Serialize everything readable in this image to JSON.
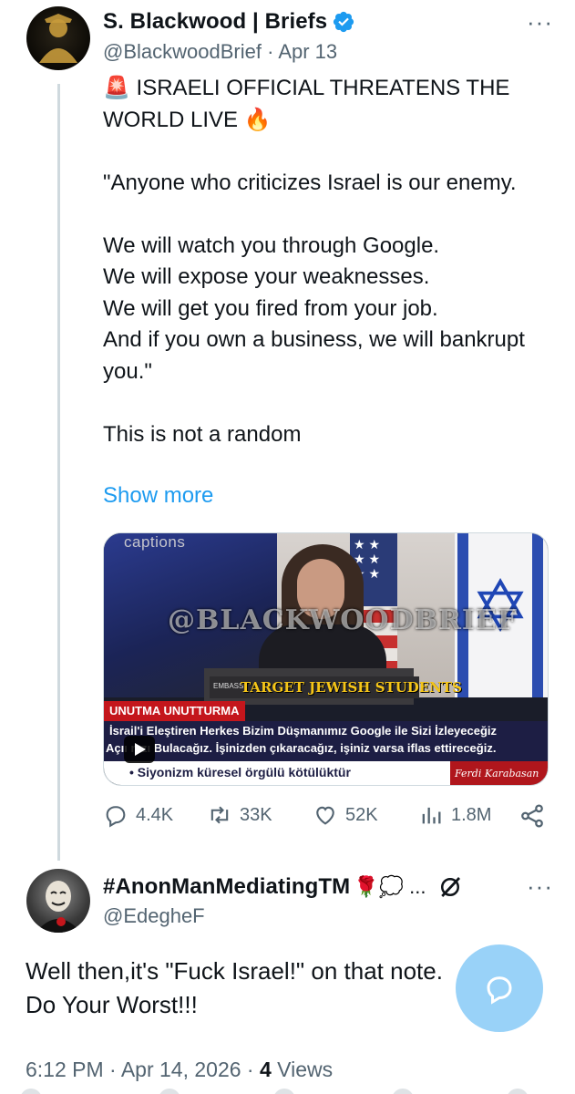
{
  "original_tweet": {
    "author": {
      "display_name": "S. Blackwood | Briefs",
      "handle": "@BlackwoodBrief",
      "date": "Apr 13",
      "verified": true
    },
    "more_label": "···",
    "text": "🚨 ISRAELI OFFICIAL THREATENS THE WORLD LIVE 🔥\n\n\"Anyone who criticizes Israel is our enemy.\n\nWe will watch you through Google.\nWe will expose your weaknesses.\nWe will get you fired from your job.\nAnd if you own a business, we will bankrupt you.\"\n\nThis is not a random",
    "show_more_label": "Show more",
    "media": {
      "captions_label": "captions",
      "watermark": "@BLACKWOODBRIEF",
      "overlay_title": "TARGET JEWISH STUDENTS",
      "podium_text": "EMBASSY",
      "tag": "UNUTMA UNUTTURMA",
      "subtitle_line1": "İsrail'i Eleştiren Herkes Bizim Düşmanımız Google ile Sizi İzleyeceğiz",
      "subtitle_line2": "Açıı  nızı Bulacağız. İşinizden çıkaracağız, işiniz varsa iflas ettireceğiz.",
      "ticker": "• Siyonizm küresel örgülü kötülüktür",
      "signature": "Ferdi Karabasan"
    },
    "actions": {
      "replies": "4.4K",
      "reposts": "33K",
      "likes": "52K",
      "views": "1.8M"
    }
  },
  "reply_tweet": {
    "author": {
      "display_name": "#AnonManMediatingTM",
      "emoji_suffix": "🌹💭 ...",
      "handle": "@EdegheF"
    },
    "more_label": "···",
    "text": "Well then,it's \"Fuck Israel!\" on that note.\nDo Your Worst!!!",
    "meta_time": "6:12 PM · Apr 14, 2026 · ",
    "meta_views_count": "4",
    "meta_views_label": " Views"
  },
  "colors": {
    "accent": "#1d9bf0",
    "secondary_text": "#536471",
    "primary_text": "#0f1419"
  }
}
